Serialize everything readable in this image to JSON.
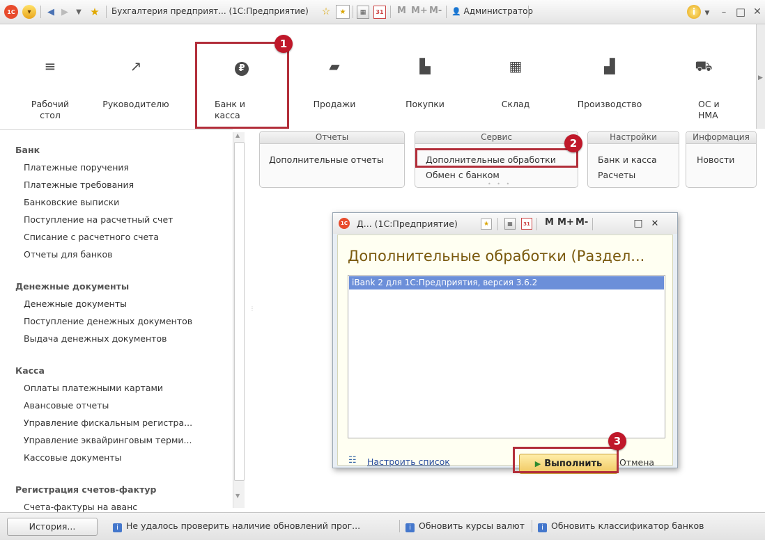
{
  "titlebar": {
    "title": "Бухгалтерия предприят... (1С:Предприятие)",
    "m": "M",
    "m_plus": "M+",
    "m_minus": "M-",
    "user": "Администратор",
    "logo_text": "1С",
    "calendar_day": "31",
    "min": "–",
    "max": "□",
    "close": "✕"
  },
  "sections": [
    {
      "label": "Рабочий\nстол",
      "icon": "list-icon"
    },
    {
      "label": "Руководителю",
      "icon": "trend-icon"
    },
    {
      "label": "Банк и\nкасса",
      "icon": "ruble-icon"
    },
    {
      "label": "Продажи",
      "icon": "bag-icon"
    },
    {
      "label": "Покупки",
      "icon": "cart-icon"
    },
    {
      "label": "Склад",
      "icon": "warehouse-icon"
    },
    {
      "label": "Производство",
      "icon": "factory-icon"
    },
    {
      "label": "ОС и\nНМА",
      "icon": "truck-icon"
    }
  ],
  "nav": {
    "bank": {
      "title": "Банк",
      "items": [
        "Платежные поручения",
        "Платежные требования",
        "Банковские выписки",
        "Поступление на расчетный счет",
        "Списание с расчетного счета",
        "Отчеты для банков"
      ]
    },
    "money_docs": {
      "title": "Денежные документы",
      "items": [
        "Денежные документы",
        "Поступление денежных документов",
        "Выдача денежных документов"
      ]
    },
    "cash": {
      "title": "Касса",
      "items": [
        "Оплаты платежными картами",
        "Авансовые отчеты",
        "Управление фискальным регистра...",
        "Управление эквайринговым терми...",
        "Кассовые документы"
      ]
    },
    "invoices": {
      "title": "Регистрация счетов-фактур",
      "items": [
        "Счета-фактуры на аванс"
      ]
    }
  },
  "commands": {
    "reports": {
      "title": "Отчеты",
      "items": [
        "Дополнительные отчеты"
      ]
    },
    "service": {
      "title": "Сервис",
      "items": [
        "Дополнительные обработки",
        "Обмен с банком"
      ]
    },
    "settings": {
      "title": "Настройки",
      "items": [
        "Банк и касса",
        "Расчеты"
      ]
    },
    "info": {
      "title": "Информация",
      "items": [
        "Новости"
      ]
    }
  },
  "dialog": {
    "title": "Д... (1С:Предприятие)",
    "logo_text": "1С",
    "calendar_day": "31",
    "m": "M",
    "m_plus": "M+",
    "m_minus": "M-",
    "max": "□",
    "close": "✕",
    "heading": "Дополнительные обработки (Раздел...",
    "list_items": [
      "iBank 2 для 1С:Предприятия, версия 3.6.2"
    ],
    "configure_link": "Настроить список",
    "run_button": "Выполнить",
    "cancel_button": "Отмена"
  },
  "badges": [
    "1",
    "2",
    "3"
  ],
  "statusbar": {
    "history_button": "История...",
    "messages": [
      "Не удалось проверить наличие обновлений прог...",
      "Обновить курсы валют",
      "Обновить классификатор банков"
    ],
    "info_glyph": "i"
  },
  "colors": {
    "accent_red": "#b22e3a",
    "heading_brown": "#7a5a0e",
    "selection_blue": "#6c8fd9"
  }
}
